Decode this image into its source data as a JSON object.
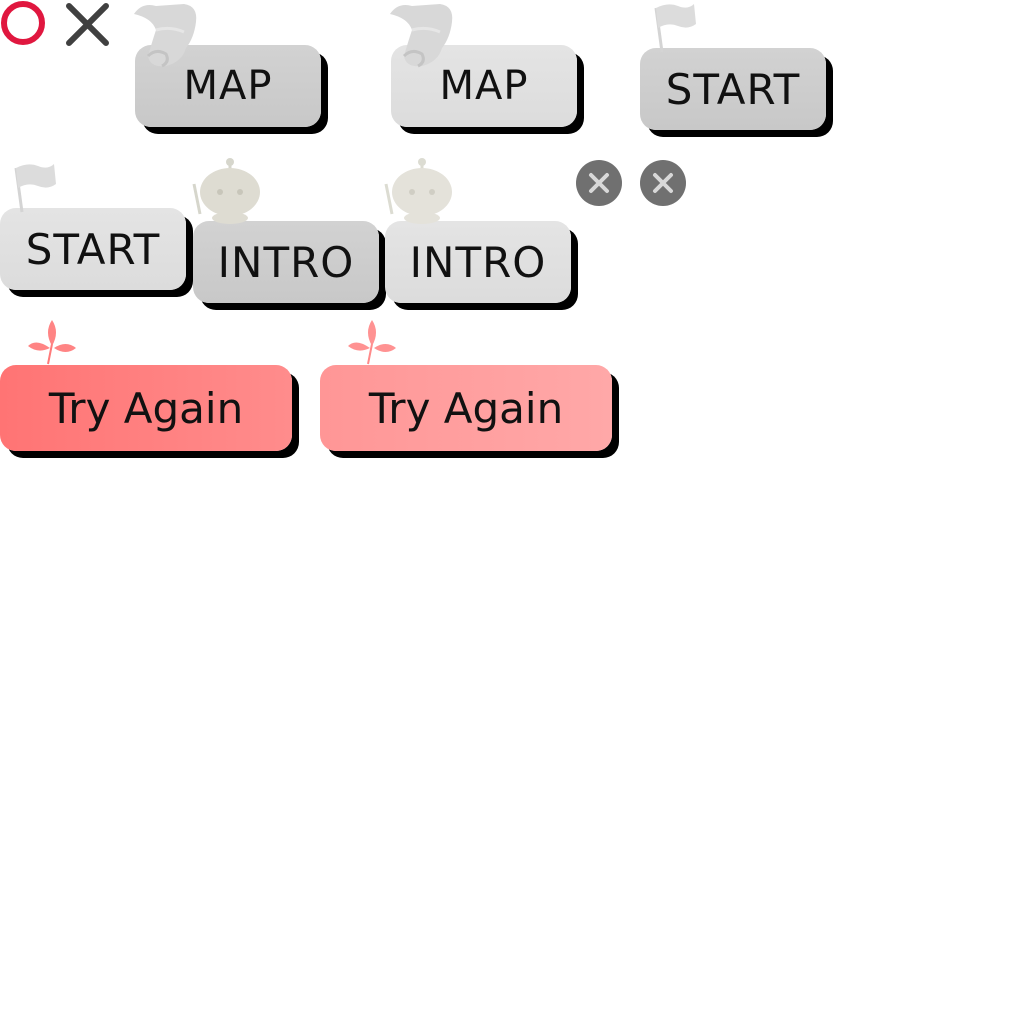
{
  "top_icons": {
    "correct_icon": "circle-o-icon",
    "wrong_icon": "x-mark-icon",
    "correct_color": "#e0173f",
    "wrong_color": "#404040"
  },
  "buttons": {
    "map_normal": "MAP",
    "map_hover": "MAP",
    "start_normal_top": "START",
    "start_hover": "START",
    "intro_normal": "INTRO",
    "intro_hover": "INTRO",
    "try_again_normal": "Try Again",
    "try_again_hover": "Try Again"
  },
  "close_buttons": [
    "close-icon",
    "close-icon"
  ],
  "colors": {
    "gray_dark": "#cccccc",
    "gray_light": "#e0e0e0",
    "red_dark": "#ff7f7f",
    "red_light": "#ff9e9e",
    "shadow": "#000000",
    "close_bg": "#707070"
  }
}
